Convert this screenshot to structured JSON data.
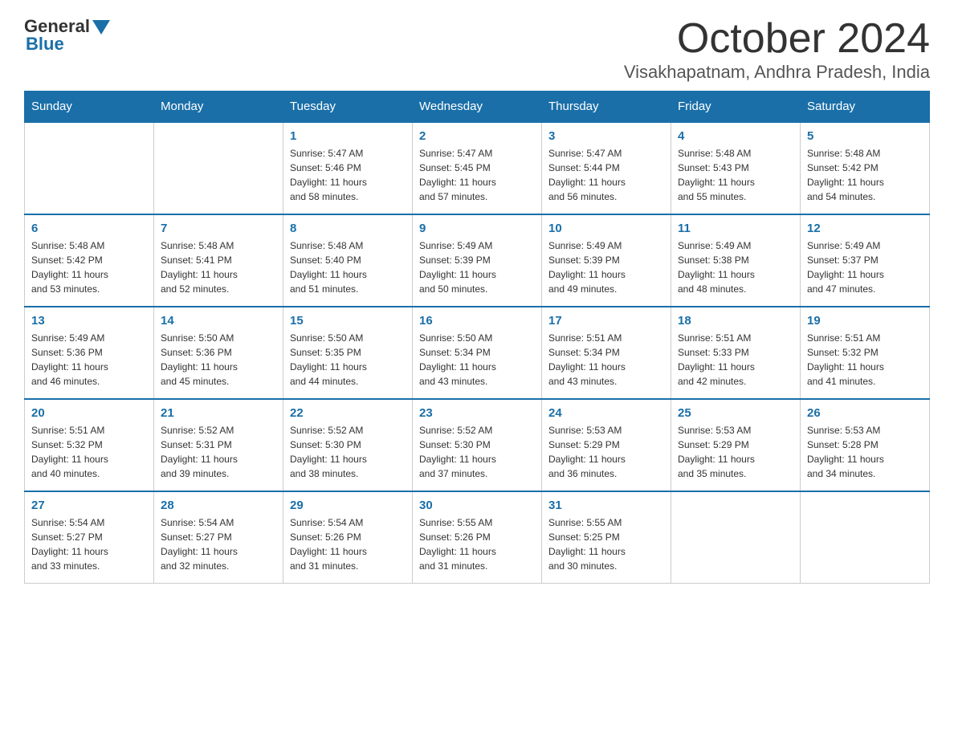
{
  "header": {
    "logo_general": "General",
    "logo_blue": "Blue",
    "month_year": "October 2024",
    "location": "Visakhapatnam, Andhra Pradesh, India"
  },
  "weekdays": [
    "Sunday",
    "Monday",
    "Tuesday",
    "Wednesday",
    "Thursday",
    "Friday",
    "Saturday"
  ],
  "weeks": [
    [
      {
        "day": "",
        "info": ""
      },
      {
        "day": "",
        "info": ""
      },
      {
        "day": "1",
        "info": "Sunrise: 5:47 AM\nSunset: 5:46 PM\nDaylight: 11 hours\nand 58 minutes."
      },
      {
        "day": "2",
        "info": "Sunrise: 5:47 AM\nSunset: 5:45 PM\nDaylight: 11 hours\nand 57 minutes."
      },
      {
        "day": "3",
        "info": "Sunrise: 5:47 AM\nSunset: 5:44 PM\nDaylight: 11 hours\nand 56 minutes."
      },
      {
        "day": "4",
        "info": "Sunrise: 5:48 AM\nSunset: 5:43 PM\nDaylight: 11 hours\nand 55 minutes."
      },
      {
        "day": "5",
        "info": "Sunrise: 5:48 AM\nSunset: 5:42 PM\nDaylight: 11 hours\nand 54 minutes."
      }
    ],
    [
      {
        "day": "6",
        "info": "Sunrise: 5:48 AM\nSunset: 5:42 PM\nDaylight: 11 hours\nand 53 minutes."
      },
      {
        "day": "7",
        "info": "Sunrise: 5:48 AM\nSunset: 5:41 PM\nDaylight: 11 hours\nand 52 minutes."
      },
      {
        "day": "8",
        "info": "Sunrise: 5:48 AM\nSunset: 5:40 PM\nDaylight: 11 hours\nand 51 minutes."
      },
      {
        "day": "9",
        "info": "Sunrise: 5:49 AM\nSunset: 5:39 PM\nDaylight: 11 hours\nand 50 minutes."
      },
      {
        "day": "10",
        "info": "Sunrise: 5:49 AM\nSunset: 5:39 PM\nDaylight: 11 hours\nand 49 minutes."
      },
      {
        "day": "11",
        "info": "Sunrise: 5:49 AM\nSunset: 5:38 PM\nDaylight: 11 hours\nand 48 minutes."
      },
      {
        "day": "12",
        "info": "Sunrise: 5:49 AM\nSunset: 5:37 PM\nDaylight: 11 hours\nand 47 minutes."
      }
    ],
    [
      {
        "day": "13",
        "info": "Sunrise: 5:49 AM\nSunset: 5:36 PM\nDaylight: 11 hours\nand 46 minutes."
      },
      {
        "day": "14",
        "info": "Sunrise: 5:50 AM\nSunset: 5:36 PM\nDaylight: 11 hours\nand 45 minutes."
      },
      {
        "day": "15",
        "info": "Sunrise: 5:50 AM\nSunset: 5:35 PM\nDaylight: 11 hours\nand 44 minutes."
      },
      {
        "day": "16",
        "info": "Sunrise: 5:50 AM\nSunset: 5:34 PM\nDaylight: 11 hours\nand 43 minutes."
      },
      {
        "day": "17",
        "info": "Sunrise: 5:51 AM\nSunset: 5:34 PM\nDaylight: 11 hours\nand 43 minutes."
      },
      {
        "day": "18",
        "info": "Sunrise: 5:51 AM\nSunset: 5:33 PM\nDaylight: 11 hours\nand 42 minutes."
      },
      {
        "day": "19",
        "info": "Sunrise: 5:51 AM\nSunset: 5:32 PM\nDaylight: 11 hours\nand 41 minutes."
      }
    ],
    [
      {
        "day": "20",
        "info": "Sunrise: 5:51 AM\nSunset: 5:32 PM\nDaylight: 11 hours\nand 40 minutes."
      },
      {
        "day": "21",
        "info": "Sunrise: 5:52 AM\nSunset: 5:31 PM\nDaylight: 11 hours\nand 39 minutes."
      },
      {
        "day": "22",
        "info": "Sunrise: 5:52 AM\nSunset: 5:30 PM\nDaylight: 11 hours\nand 38 minutes."
      },
      {
        "day": "23",
        "info": "Sunrise: 5:52 AM\nSunset: 5:30 PM\nDaylight: 11 hours\nand 37 minutes."
      },
      {
        "day": "24",
        "info": "Sunrise: 5:53 AM\nSunset: 5:29 PM\nDaylight: 11 hours\nand 36 minutes."
      },
      {
        "day": "25",
        "info": "Sunrise: 5:53 AM\nSunset: 5:29 PM\nDaylight: 11 hours\nand 35 minutes."
      },
      {
        "day": "26",
        "info": "Sunrise: 5:53 AM\nSunset: 5:28 PM\nDaylight: 11 hours\nand 34 minutes."
      }
    ],
    [
      {
        "day": "27",
        "info": "Sunrise: 5:54 AM\nSunset: 5:27 PM\nDaylight: 11 hours\nand 33 minutes."
      },
      {
        "day": "28",
        "info": "Sunrise: 5:54 AM\nSunset: 5:27 PM\nDaylight: 11 hours\nand 32 minutes."
      },
      {
        "day": "29",
        "info": "Sunrise: 5:54 AM\nSunset: 5:26 PM\nDaylight: 11 hours\nand 31 minutes."
      },
      {
        "day": "30",
        "info": "Sunrise: 5:55 AM\nSunset: 5:26 PM\nDaylight: 11 hours\nand 31 minutes."
      },
      {
        "day": "31",
        "info": "Sunrise: 5:55 AM\nSunset: 5:25 PM\nDaylight: 11 hours\nand 30 minutes."
      },
      {
        "day": "",
        "info": ""
      },
      {
        "day": "",
        "info": ""
      }
    ]
  ]
}
